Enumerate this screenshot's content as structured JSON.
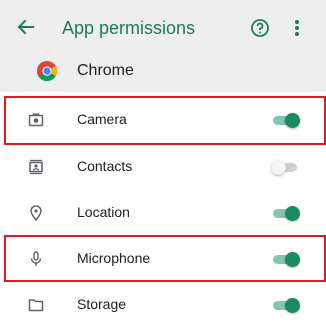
{
  "appbar": {
    "back_icon": "arrow-back-icon",
    "title": "App permissions",
    "help_icon": "help-circle-icon",
    "more_icon": "more-vert-icon"
  },
  "app": {
    "name": "Chrome",
    "icon": "chrome-logo-icon"
  },
  "permissions": [
    {
      "label": "Camera",
      "icon": "camera-icon",
      "enabled": true,
      "highlighted": true
    },
    {
      "label": "Contacts",
      "icon": "contacts-icon",
      "enabled": false,
      "highlighted": false
    },
    {
      "label": "Location",
      "icon": "location-icon",
      "enabled": true,
      "highlighted": false
    },
    {
      "label": "Microphone",
      "icon": "microphone-icon",
      "enabled": true,
      "highlighted": true
    },
    {
      "label": "Storage",
      "icon": "folder-icon",
      "enabled": true,
      "highlighted": false
    }
  ],
  "colors": {
    "accent": "#1a7a62",
    "toggle_on_thumb": "#1a8a60",
    "toggle_on_track": "#7fc8ad",
    "toggle_off_track": "#cfcfcf",
    "highlight_box": "#e01b1b",
    "header_bg": "#eeeeee"
  }
}
